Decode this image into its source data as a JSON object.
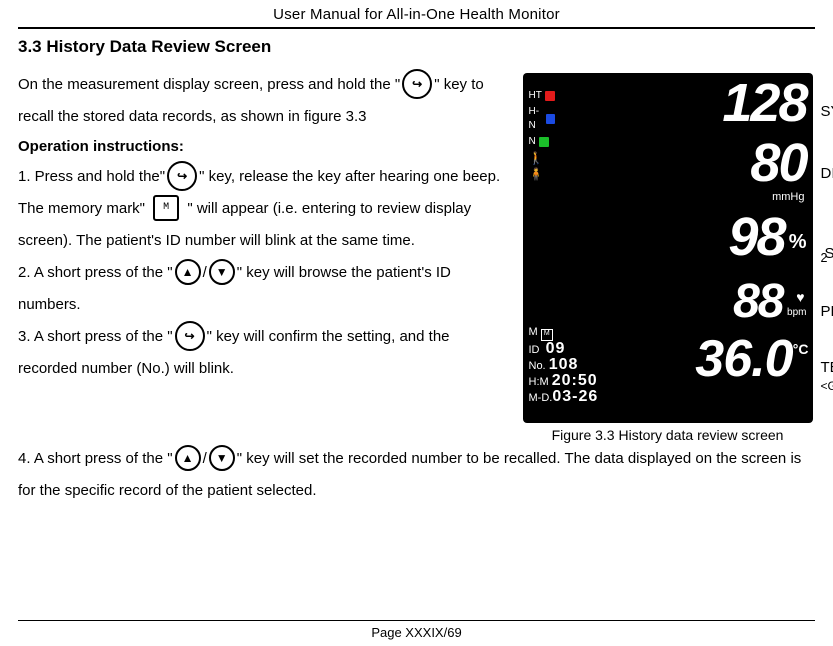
{
  "header": {
    "title": "User Manual for All-in-One Health Monitor"
  },
  "section": {
    "title": "3.3 History Data Review Screen"
  },
  "intro": {
    "part1": "On the measurement display screen, press and hold the \"",
    "part2": "\" key to recall the stored data records, as shown in figure 3.3"
  },
  "op_instr_label": "Operation instructions:",
  "steps": {
    "s1a": "1. Press and hold the\"",
    "s1b": "\" key, release the key after hearing one beep. The memory mark\" ",
    "s1c": " \" will appear (i.e. entering to review display screen). The patient's ID number will blink at the same time.",
    "s2a": "2. A short press of the \"",
    "s2_slash": "/",
    "s2b": "\" key will browse the patient's ID numbers.",
    "s3a": "3. A short press of the \"",
    "s3b": "\" key will confirm the setting, and the recorded number (No.) will blink.",
    "s4a": "4. A short press of the \"",
    "s4_slash": "/",
    "s4b": "\" key will set the recorded number to be recalled. The data displayed on the screen is for the specific record of the patient selected."
  },
  "icons": {
    "enter": "↪",
    "up": "▲",
    "down": "▼",
    "mem": "M"
  },
  "figure": {
    "caption": "Figure 3.3 History data review screen",
    "left_labels": {
      "ht": "HT",
      "hn": "H-N",
      "n": "N"
    },
    "left_lower": {
      "m_label": "M",
      "m_val": "",
      "id_label": "ID",
      "id_val": "09",
      "no_label": "No.",
      "no_val": "108",
      "hm_label": "H:M",
      "hm_val": "20:50",
      "md_label": "M-D.",
      "md_val": "03-26"
    },
    "readings": {
      "syst": "128",
      "syst_label": "SYST",
      "dias": "80",
      "dias_label": "DIAS",
      "mmhg": "mmHg",
      "spo2": "98",
      "spo2_label": "SpO",
      "spo2_sub": "2",
      "pct": "%",
      "pr": "88",
      "pr_label": "PR",
      "bpm": "bpm",
      "temp": "36.0",
      "temp_label": "TEMP",
      "degc": "°C",
      "glu_label": "<GLU>"
    }
  },
  "footer": {
    "page": "Page XXXIX/69"
  }
}
